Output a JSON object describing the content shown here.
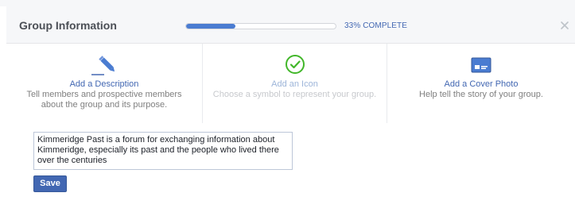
{
  "header": {
    "title": "Group Information",
    "progress_fraction": 0.33,
    "progress_label": "33% COMPLETE",
    "close_icon": "close-icon"
  },
  "steps": [
    {
      "title": "Add a Description",
      "description": "Tell members and prospective members about the group and its purpose.",
      "icon": "pencil-icon",
      "state": "active"
    },
    {
      "title": "Add an Icon",
      "description": "Choose a symbol to represent your group.",
      "icon": "checkmark-circle-icon",
      "state": "disabled"
    },
    {
      "title": "Add a Cover Photo",
      "description": "Help tell the story of your group.",
      "icon": "cover-photo-icon",
      "state": "available"
    }
  ],
  "description_field": {
    "value": "Kimmeridge Past is a forum for exchanging information about Kimmeridge, especially its past and the people who lived there over the centuries"
  },
  "save_label": "Save",
  "colors": {
    "accent": "#4267b2",
    "progress": "#4a7cd1",
    "check_green": "#42b72a",
    "header_bg": "#f6f7f9"
  }
}
